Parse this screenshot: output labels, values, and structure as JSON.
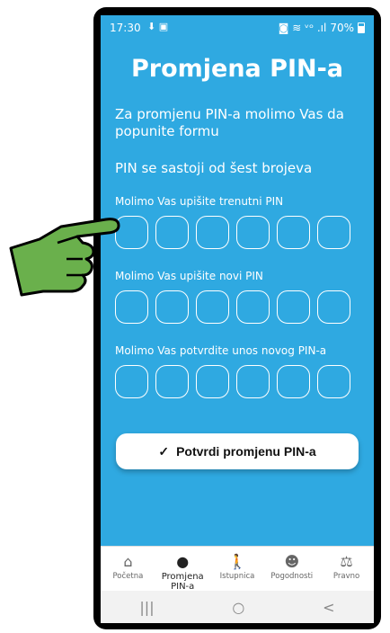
{
  "status": {
    "time": "17:30",
    "left_icons": "⬇ ▣",
    "right_icons": "◙ ≋ ᵛᵒ .ıl",
    "battery": "70%"
  },
  "title": "Promjena PIN-a",
  "intro": "Za promjenu PIN-a molimo Vas da popunite formu",
  "pin_info": "PIN se sastoji od šest brojeva",
  "fields": {
    "current_label": "Molimo Vas upišite trenutni PIN",
    "new_label": "Molimo Vas upišite novi PIN",
    "confirm_label": "Molimo Vas potvrdite unos novog PIN-a"
  },
  "confirm_button": {
    "icon": "✓",
    "label": "Potvrdi promjenu PIN-a"
  },
  "nav": [
    {
      "icon": "⌂",
      "label": "Početna"
    },
    {
      "icon": "●",
      "label": "Promjena PIN-a"
    },
    {
      "icon": "🚶",
      "label": "Istupnica"
    },
    {
      "icon": "☻",
      "label": "Pogodnosti"
    },
    {
      "icon": "⚖",
      "label": "Pravno"
    }
  ],
  "system_nav": {
    "recents": "|||",
    "home": "○",
    "back": "<"
  },
  "colors": {
    "background": "#2fa9e1",
    "button": "#ffffff",
    "hand": "#6ab04c"
  }
}
